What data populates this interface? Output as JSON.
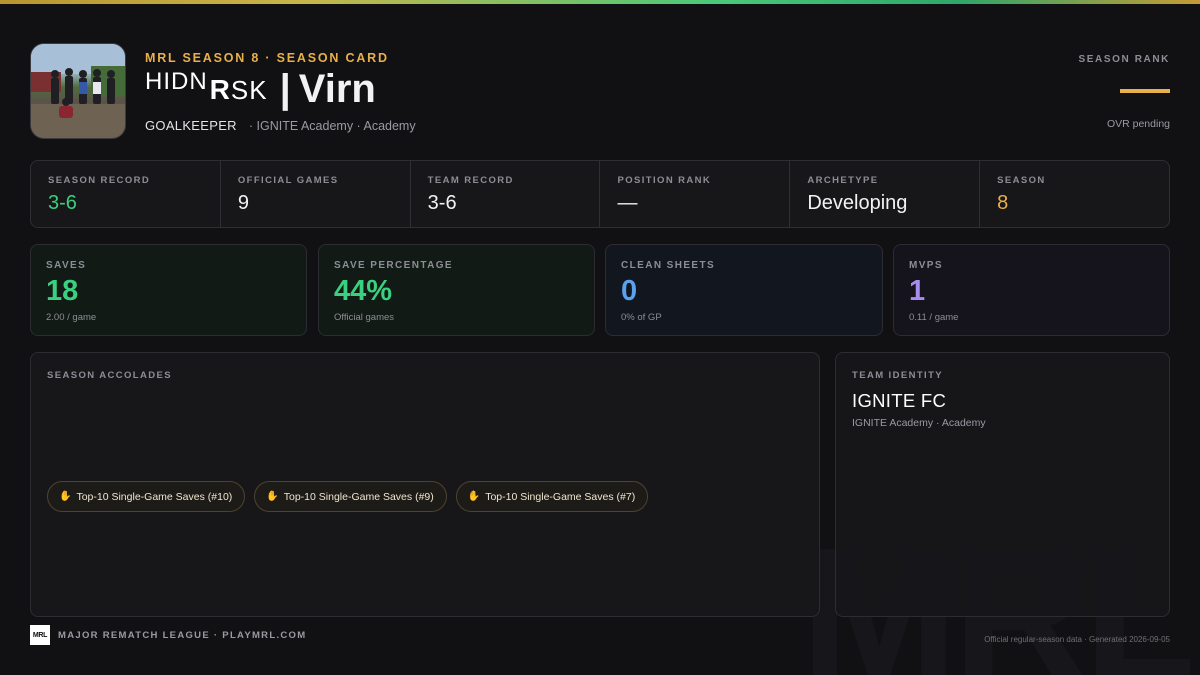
{
  "header": {
    "kicker": "MRL SEASON 8 · SEASON CARD",
    "team_logo_text_a": "HIDN",
    "team_logo_text_b_bold": "R",
    "team_logo_text_b": "SK",
    "separator": "|",
    "player_name": "Virn",
    "position": "GOALKEEPER",
    "affiliation": "· IGNITE Academy · Academy",
    "avatar_icon": "team-photo"
  },
  "season_rank": {
    "label": "SEASON RANK",
    "status": "OVR pending",
    "accent": "#e8b04a"
  },
  "summary": [
    {
      "label": "SEASON RECORD",
      "value": "3-6"
    },
    {
      "label": "OFFICIAL GAMES",
      "value": "9"
    },
    {
      "label": "TEAM RECORD",
      "value": "3-6"
    },
    {
      "label": "POSITION RANK",
      "value": "—"
    },
    {
      "label": "ARCHETYPE",
      "value": "Developing"
    },
    {
      "label": "SEASON",
      "value": "8"
    }
  ],
  "stats": [
    {
      "label": "SAVES",
      "value": "18",
      "sub": "2.00 / game",
      "color": "#39d07f"
    },
    {
      "label": "SAVE PERCENTAGE",
      "value": "44%",
      "sub": "Official games",
      "color": "#39d07f"
    },
    {
      "label": "CLEAN SHEETS",
      "value": "0",
      "sub": "0% of GP",
      "color": "#5aa2ee"
    },
    {
      "label": "MVPS",
      "value": "1",
      "sub": "0.11 / game",
      "color": "#a98cf0"
    }
  ],
  "accolades": {
    "label": "SEASON ACCOLADES",
    "icon": "goalkeeper-glove-icon",
    "items": [
      "Top-10 Single-Game Saves (#10)",
      "Top-10 Single-Game Saves (#9)",
      "Top-10 Single-Game Saves (#7)"
    ]
  },
  "team_identity": {
    "label": "TEAM IDENTITY",
    "name": "IGNITE FC",
    "sub": "IGNITE Academy · Academy"
  },
  "footer": {
    "logo": "MRL",
    "league": "MAJOR REMATCH LEAGUE · PLAYMRL.COM",
    "note": "Official regular-season data · Generated 2026-09-05",
    "watermark": "MRL"
  }
}
